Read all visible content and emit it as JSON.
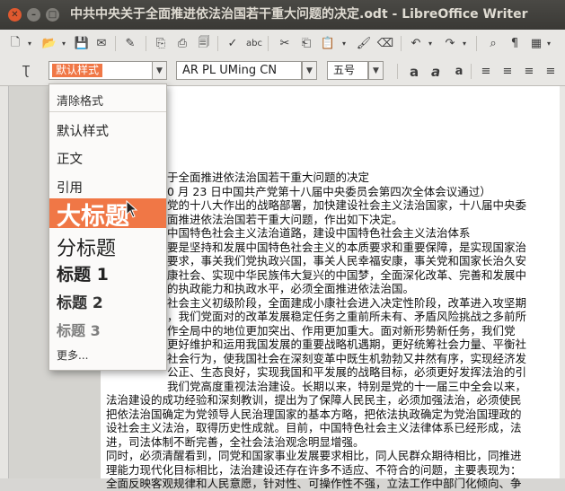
{
  "window": {
    "title": "中共中央关于全面推进依法治国若干重大问题的决定.odt - LibreOffice Writer"
  },
  "toolbar": {
    "paragraph_style": "默认样式",
    "font_name": "AR PL UMing CN",
    "font_size": "五号"
  },
  "style_menu": {
    "clear": "清除格式",
    "default": "默认样式",
    "body": "正文",
    "quote": "引用",
    "title": "大标题",
    "subtitle": "分标题",
    "heading1": "标题 1",
    "heading2": "标题 2",
    "heading3": "标题 3",
    "more": "更多..."
  },
  "document": {
    "lines": [
      "于全面推进依法治国若干重大问题的决定",
      "0 月 23 日中国共产党第十八届中央委员会第四次全体会议通过）",
      "党的十八大作出的战略部署，加快建设社会主义法治国家，十八届中央委",
      "面推进依法治国若干重大问题，作出如下决定。",
      "中国特色社会主义法治道路，建设中国特色社会主义法治体系",
      "要是坚持和发展中国特色社会主义的本质要求和重要保障，是实现国家治",
      "要求，事关我们党执政兴国，事关人民幸福安康，事关党和国家长治久安",
      "康社会、实现中华民族伟大复兴的中国梦，全面深化改革、完善和发展中",
      "的执政能力和执政水平，必须全面推进依法治国。",
      "社会主义初级阶段，全面建成小康社会进入决定性阶段，改革进入攻坚期",
      "，我们党面对的改革发展稳定任务之重前所未有、矛盾风险挑战之多前所",
      "作全局中的地位更加突出、作用更加重大。面对新形势新任务，我们党",
      "更好维护和运用我国发展的重要战略机遇期，更好统筹社会力量、平衡社",
      "社会行为，使我国社会在深刻变革中既生机勃勃又井然有序，实现经济发",
      "公正、生态良好，实现我国和平发展的战略目标，必须更好发挥法治的引",
      "我们党高度重视法治建设。长期以来，特别是党的十一届三中全会以来，",
      "法治建设的成功经验和深刻教训，提出为了保障人民民主，必须加强法治，必须使民",
      "把依法治国确定为党领导人民治理国家的基本方略，把依法执政确定为党治国理政的",
      "设社会主义法治，取得历史性成就。目前，中国特色社会主义法律体系已经形成，法",
      "进，司法体制不断完善，全社会法治观念明显增强。",
      "同时，必须清醒看到，同党和国家事业发展要求相比，同人民群众期待相比，同推进",
      "理能力现代化目标相比，法治建设还存在许多不适应、不符合的问题，主要表现为：",
      "全面反映客观规律和人民意愿，针对性、可操作性不强，立法工作中部门化倾向、争"
    ]
  }
}
